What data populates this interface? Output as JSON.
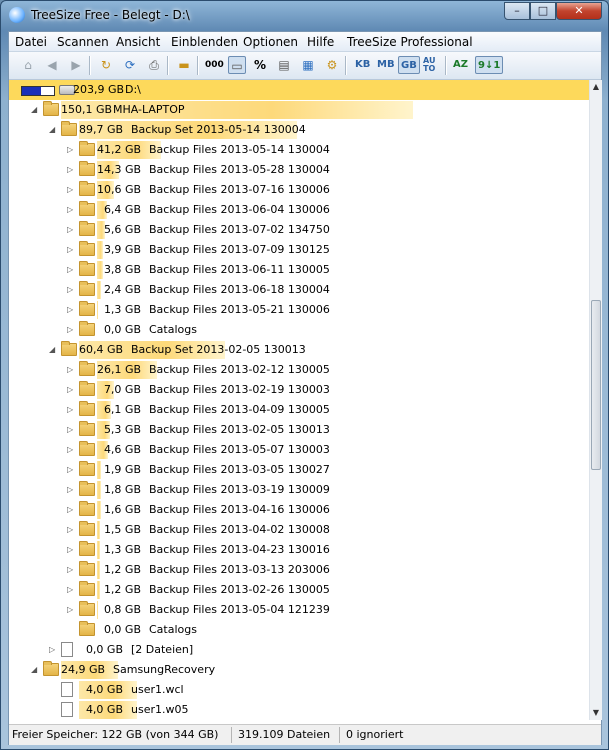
{
  "window": {
    "title": "TreeSize Free - Belegt - D:\\"
  },
  "titlebar_buttons": {
    "minimize": "–",
    "maximize": "□",
    "close": "✕"
  },
  "menu": [
    "Datei",
    "Scannen",
    "Ansicht",
    "Einblenden",
    "Optionen",
    "Hilfe",
    "TreeSize Professional"
  ],
  "toolbar": {
    "icons": [
      "home-icon",
      "back-icon",
      "forward-icon",
      "refresh-folder-icon",
      "rescan-icon",
      "print-icon",
      "folder-icon",
      "size-icon",
      "drive-icon",
      "percent-icon",
      "files-icon",
      "details-icon",
      "tools-icon"
    ],
    "unit_kb": "KB",
    "unit_mb": "MB",
    "unit_gb": "GB",
    "unit_auto_top": "AU",
    "unit_auto_bottom": "TO",
    "sort_az": "AZ",
    "sort_size": "9↓1",
    "percent_label": "%",
    "counter_label": "000"
  },
  "tree": [
    {
      "level": 0,
      "type": "drive",
      "size": "203,9 GB",
      "name": "D:\\",
      "expander": "",
      "selected": true,
      "fill": 1.0
    },
    {
      "level": 1,
      "type": "folder",
      "size": "150,1 GB",
      "name": "MHA-LAPTOP",
      "expander": "◢",
      "fill": 0.74
    },
    {
      "level": 2,
      "type": "folder",
      "size": "89,7 GB",
      "name": "Backup Set 2013-05-14 130004",
      "expander": "◢",
      "fill": 0.6
    },
    {
      "level": 3,
      "type": "folder",
      "size": "41,2 GB",
      "name": "Backup Files 2013-05-14 130004",
      "expander": "▷",
      "fill": 0.46
    },
    {
      "level": 3,
      "type": "folder",
      "size": "14,3 GB",
      "name": "Backup Files 2013-05-28 130004",
      "expander": "▷",
      "fill": 0.16
    },
    {
      "level": 3,
      "type": "folder",
      "size": "10,6 GB",
      "name": "Backup Files 2013-07-16 130006",
      "expander": "▷",
      "fill": 0.12
    },
    {
      "level": 3,
      "type": "folder",
      "size": "6,4 GB",
      "name": "Backup Files 2013-06-04 130006",
      "expander": "▷",
      "fill": 0.07
    },
    {
      "level": 3,
      "type": "folder",
      "size": "5,6 GB",
      "name": "Backup Files 2013-07-02 134750",
      "expander": "▷",
      "fill": 0.06
    },
    {
      "level": 3,
      "type": "folder",
      "size": "3,9 GB",
      "name": "Backup Files 2013-07-09 130125",
      "expander": "▷",
      "fill": 0.04
    },
    {
      "level": 3,
      "type": "folder",
      "size": "3,8 GB",
      "name": "Backup Files 2013-06-11 130005",
      "expander": "▷",
      "fill": 0.04
    },
    {
      "level": 3,
      "type": "folder",
      "size": "2,4 GB",
      "name": "Backup Files 2013-06-18 130004",
      "expander": "▷",
      "fill": 0.03
    },
    {
      "level": 3,
      "type": "folder",
      "size": "1,3 GB",
      "name": "Backup Files 2013-05-21 130006",
      "expander": "▷",
      "fill": 0.01
    },
    {
      "level": 3,
      "type": "folder",
      "size": "0,0 GB",
      "name": "Catalogs",
      "expander": "▷",
      "fill": 0.0
    },
    {
      "level": 2,
      "type": "folder",
      "size": "60,4 GB",
      "name": "Backup Set 2013-02-05 130013",
      "expander": "◢",
      "fill": 0.4
    },
    {
      "level": 3,
      "type": "folder",
      "size": "26,1 GB",
      "name": "Backup Files 2013-02-12 130005",
      "expander": "▷",
      "fill": 0.43
    },
    {
      "level": 3,
      "type": "folder",
      "size": "7,0 GB",
      "name": "Backup Files 2013-02-19 130003",
      "expander": "▷",
      "fill": 0.12
    },
    {
      "level": 3,
      "type": "folder",
      "size": "6,1 GB",
      "name": "Backup Files 2013-04-09 130005",
      "expander": "▷",
      "fill": 0.1
    },
    {
      "level": 3,
      "type": "folder",
      "size": "5,3 GB",
      "name": "Backup Files 2013-02-05 130013",
      "expander": "▷",
      "fill": 0.09
    },
    {
      "level": 3,
      "type": "folder",
      "size": "4,6 GB",
      "name": "Backup Files 2013-05-07 130003",
      "expander": "▷",
      "fill": 0.08
    },
    {
      "level": 3,
      "type": "folder",
      "size": "1,9 GB",
      "name": "Backup Files 2013-03-05 130027",
      "expander": "▷",
      "fill": 0.03
    },
    {
      "level": 3,
      "type": "folder",
      "size": "1,8 GB",
      "name": "Backup Files 2013-03-19 130009",
      "expander": "▷",
      "fill": 0.03
    },
    {
      "level": 3,
      "type": "folder",
      "size": "1,6 GB",
      "name": "Backup Files 2013-04-16 130006",
      "expander": "▷",
      "fill": 0.03
    },
    {
      "level": 3,
      "type": "folder",
      "size": "1,5 GB",
      "name": "Backup Files 2013-04-02 130008",
      "expander": "▷",
      "fill": 0.02
    },
    {
      "level": 3,
      "type": "folder",
      "size": "1,3 GB",
      "name": "Backup Files 2013-04-23 130016",
      "expander": "▷",
      "fill": 0.02
    },
    {
      "level": 3,
      "type": "folder",
      "size": "1,2 GB",
      "name": "Backup Files 2013-03-13 203006",
      "expander": "▷",
      "fill": 0.02
    },
    {
      "level": 3,
      "type": "folder",
      "size": "1,2 GB",
      "name": "Backup Files 2013-02-26 130005",
      "expander": "▷",
      "fill": 0.02
    },
    {
      "level": 3,
      "type": "folder",
      "size": "0,8 GB",
      "name": "Backup Files 2013-05-04 121239",
      "expander": "▷",
      "fill": 0.01
    },
    {
      "level": 3,
      "type": "folder",
      "size": "0,0 GB",
      "name": "Catalogs",
      "expander": "",
      "fill": 0.0
    },
    {
      "level": 2,
      "type": "file",
      "size": "0,0 GB",
      "name": "[2 Dateien]",
      "expander": "▷",
      "fill": 0.0
    },
    {
      "level": 1,
      "type": "folder",
      "size": "24,9 GB",
      "name": "SamsungRecovery",
      "expander": "◢",
      "fill": 0.12
    },
    {
      "level": 2,
      "type": "file",
      "size": "4,0 GB",
      "name": "user1.wcl",
      "expander": "",
      "fill": 0.16
    },
    {
      "level": 2,
      "type": "file",
      "size": "4,0 GB",
      "name": "user1.w05",
      "expander": "",
      "fill": 0.16
    }
  ],
  "status": {
    "free": "Freier Speicher: 122 GB  (von 344 GB)",
    "files": "319.109  Dateien",
    "ignored": "0 ignoriert"
  },
  "colors": {
    "selection": "#fdd95b",
    "bar": "#fdd97a",
    "title_bar": "#5f89b3"
  }
}
